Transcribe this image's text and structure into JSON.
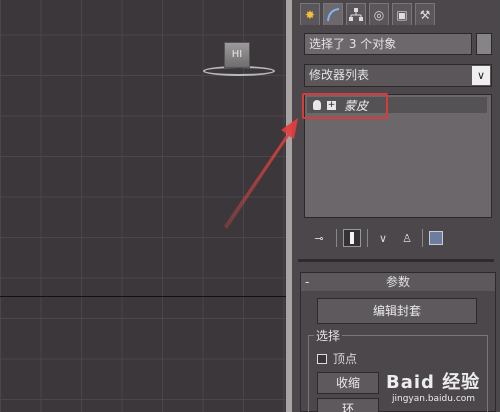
{
  "viewport": {
    "helper_label": "HI"
  },
  "panel": {
    "tabs": [
      {
        "name": "create",
        "icon": "star-icon",
        "glyph": "✸"
      },
      {
        "name": "modify",
        "icon": "curve-icon",
        "glyph": ""
      },
      {
        "name": "hierarchy",
        "icon": "hierarchy-icon",
        "glyph": ""
      },
      {
        "name": "motion",
        "icon": "motion-icon",
        "glyph": "◎"
      },
      {
        "name": "display",
        "icon": "display-icon",
        "glyph": "▣"
      },
      {
        "name": "utilities",
        "icon": "hammer-icon",
        "glyph": "⚒"
      }
    ],
    "selection_text": "选择了 3 个对象",
    "modifier_list": "修改器列表",
    "modifier_dropdown_glyph": "∨",
    "stack_item": "蒙皮",
    "toolbar": {
      "pin_glyph": "⊸",
      "fork_glyph": "∨",
      "lock_glyph": "♙"
    },
    "params": {
      "header": "参数",
      "collapse": "-",
      "edit_envelope": "编辑封套",
      "selection_group": "选择",
      "vertex_label": "顶点",
      "shrink": "收缩",
      "loop": "环"
    }
  },
  "watermark": {
    "brand": "Baid 经验",
    "url": "jingyan.baidu.com"
  },
  "colors": {
    "highlight": "#d93a3a",
    "viewport_bg": "#3b373b",
    "panel_bg": "#4b474b"
  }
}
